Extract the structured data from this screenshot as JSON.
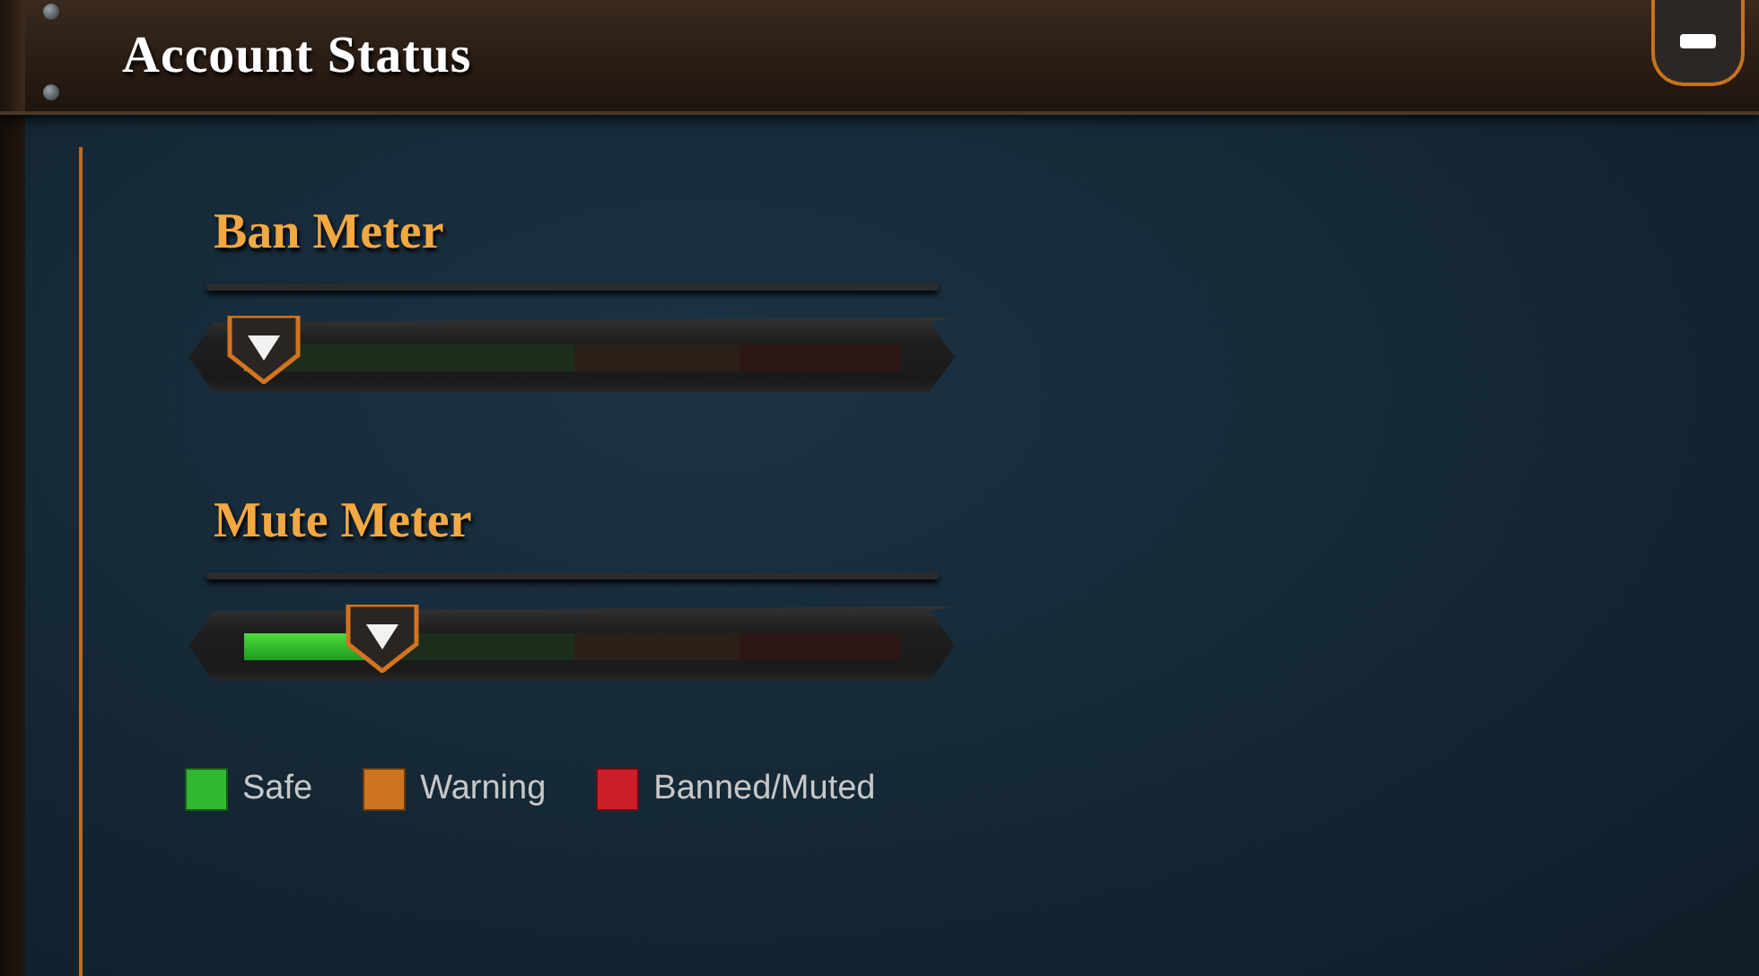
{
  "window": {
    "title": "Account Status"
  },
  "meters": [
    {
      "label": "Ban Meter",
      "level": 0.03
    },
    {
      "label": "Mute Meter",
      "level": 0.21
    }
  ],
  "legend": [
    {
      "label": "Safe",
      "color": "#33b833"
    },
    {
      "label": "Warning",
      "color": "#cc7420"
    },
    {
      "label": "Banned/Muted",
      "color": "#cc1f2a"
    }
  ]
}
